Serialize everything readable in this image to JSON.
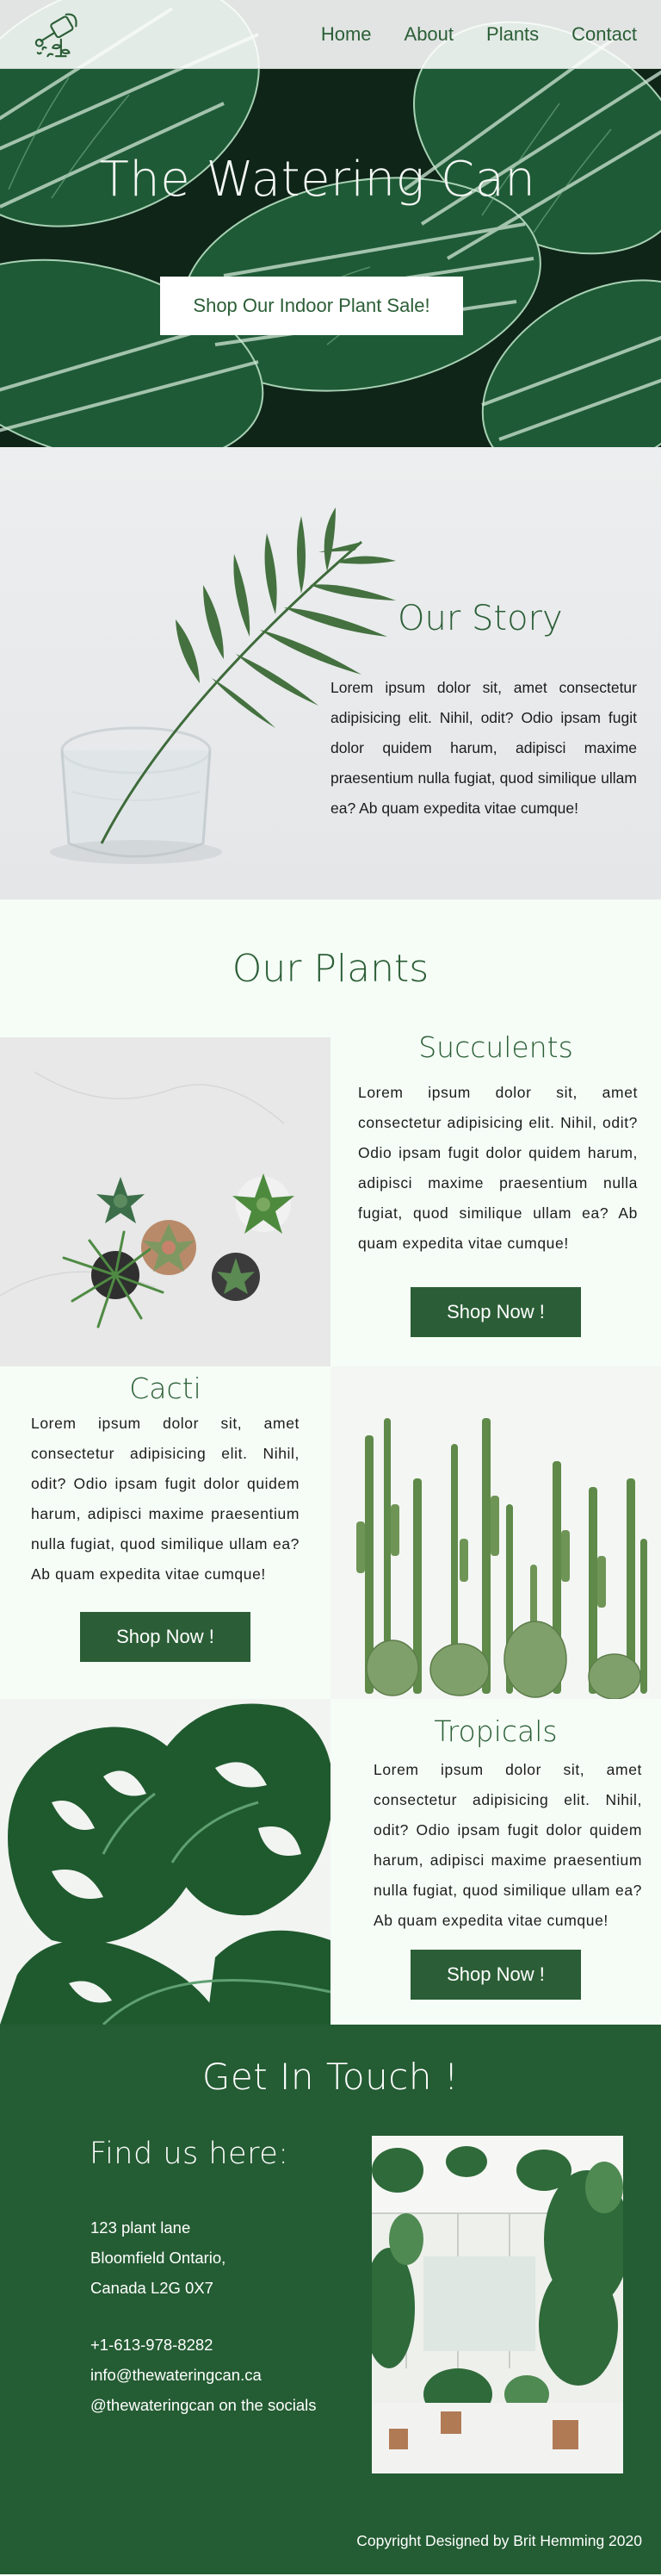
{
  "nav": {
    "links": [
      "Home",
      "About",
      "Plants",
      "Contact"
    ],
    "logo_icon": "watering-can-icon"
  },
  "hero": {
    "title": "The Watering Can",
    "button_label": "Shop Our Indoor Plant Sale!"
  },
  "story": {
    "title": "Our Story",
    "body": "Lorem ipsum dolor sit, amet consectetur adipisicing elit. Nihil, odit? Odio ipsam fugit dolor quidem harum, adipisci maxime praesentium nulla fugiat, quod similique ullam ea? Ab quam expedita vitae cumque!"
  },
  "plants": {
    "heading": "Our Plants",
    "items": [
      {
        "name": "Succulents",
        "body": "Lorem ipsum dolor sit, amet consectetur adipisicing elit. Nihil, odit? Odio ipsam fugit dolor quidem harum, adipisci maxime praesentium nulla fugiat, quod similique ullam ea? Ab quam expedita vitae cumque!",
        "button_label": "Shop Now !"
      },
      {
        "name": "Cacti",
        "body": "Lorem ipsum dolor sit, amet consectetur adipisicing elit. Nihil, odit? Odio ipsam fugit dolor quidem harum, adipisci maxime praesentium nulla fugiat, quod similique ullam ea? Ab quam expedita vitae cumque!",
        "button_label": "Shop Now !"
      },
      {
        "name": "Tropicals",
        "body": "Lorem ipsum dolor sit, amet consectetur adipisicing elit. Nihil, odit? Odio ipsam fugit dolor quidem harum, adipisci maxime praesentium nulla fugiat, quod similique ullam ea? Ab quam expedita vitae cumque!",
        "button_label": "Shop Now !"
      }
    ]
  },
  "contact": {
    "title": "Get In Touch !",
    "subtitle": "Find us here:",
    "address": [
      "123 plant lane",
      "Bloomfield Ontario,",
      "Canada L2G 0X7"
    ],
    "phone": "+1-613-978-8282",
    "email": "info@thewateringcan.ca",
    "social": "@thewateringcan on the socials",
    "copyright": "Copyright Designed by Brit Hemming 2020"
  },
  "colors": {
    "brand_green": "#2b5e36",
    "footer_green": "#245c33",
    "page_bg": "#f5fdf6"
  }
}
